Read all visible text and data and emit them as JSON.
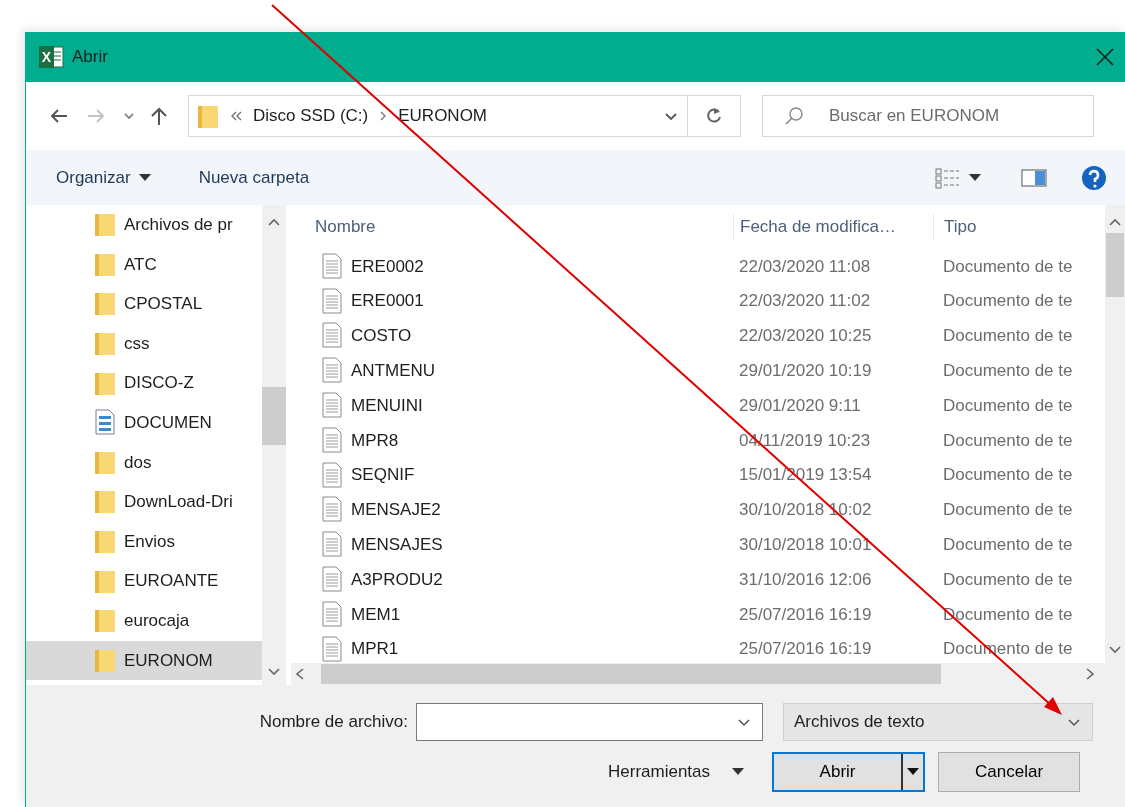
{
  "window": {
    "app_icon_letter": "X",
    "title": "Abrir"
  },
  "address": {
    "path": [
      "Disco SSD (C:)",
      "EURONOM"
    ]
  },
  "search": {
    "placeholder": "Buscar en EURONOM"
  },
  "toolbar": {
    "organize": "Organizar",
    "new_folder": "Nueva carpeta"
  },
  "nav": [
    {
      "label": "Archivos de pr",
      "kind": "folder",
      "selected": false
    },
    {
      "label": "ATC",
      "kind": "folder",
      "selected": false
    },
    {
      "label": "CPOSTAL",
      "kind": "folder",
      "selected": false
    },
    {
      "label": "css",
      "kind": "folder",
      "selected": false
    },
    {
      "label": "DISCO-Z",
      "kind": "folder",
      "selected": false
    },
    {
      "label": "DOCUMEN",
      "kind": "document",
      "selected": false
    },
    {
      "label": "dos",
      "kind": "folder",
      "selected": false
    },
    {
      "label": "DownLoad-Dri",
      "kind": "folder",
      "selected": false
    },
    {
      "label": "Envios",
      "kind": "folder",
      "selected": false
    },
    {
      "label": "EUROANTE",
      "kind": "folder",
      "selected": false
    },
    {
      "label": "eurocaja",
      "kind": "folder",
      "selected": false
    },
    {
      "label": "EURONOM",
      "kind": "folder",
      "selected": true
    }
  ],
  "columns": [
    "Nombre",
    "Fecha de modifica…",
    "Tipo"
  ],
  "rows": [
    {
      "name": "ERE0002",
      "date": "22/03/2020 11:08",
      "type": "Documento de te"
    },
    {
      "name": "ERE0001",
      "date": "22/03/2020 11:02",
      "type": "Documento de te"
    },
    {
      "name": "COSTO",
      "date": "22/03/2020 10:25",
      "type": "Documento de te"
    },
    {
      "name": "ANTMENU",
      "date": "29/01/2020 10:19",
      "type": "Documento de te"
    },
    {
      "name": "MENUINI",
      "date": "29/01/2020 9:11",
      "type": "Documento de te"
    },
    {
      "name": "MPR8",
      "date": "04/11/2019 10:23",
      "type": "Documento de te"
    },
    {
      "name": "SEQNIF",
      "date": "15/01/2019 13:54",
      "type": "Documento de te"
    },
    {
      "name": "MENSAJE2",
      "date": "30/10/2018 10:02",
      "type": "Documento de te"
    },
    {
      "name": "MENSAJES",
      "date": "30/10/2018 10:01",
      "type": "Documento de te"
    },
    {
      "name": "A3PRODU2",
      "date": "31/10/2016 12:06",
      "type": "Documento de te"
    },
    {
      "name": "MEM1",
      "date": "25/07/2016 16:19",
      "type": "Documento de te"
    },
    {
      "name": "MPR1",
      "date": "25/07/2016 16:19",
      "type": "Documento de te"
    }
  ],
  "footer": {
    "filename_label": "Nombre de archivo:",
    "file_type": "Archivos de texto",
    "tools": "Herramientas",
    "open": "Abrir",
    "cancel": "Cancelar"
  }
}
